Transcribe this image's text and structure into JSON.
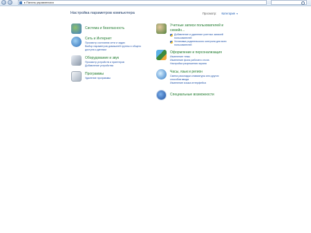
{
  "address": {
    "path": "Панель управления",
    "arrow": "▸"
  },
  "header": {
    "title": "Настройка параметров компьютера",
    "view_by_label": "Просмотр:",
    "view_by_value": "Категория",
    "view_by_arrow": "▾"
  },
  "left": [
    {
      "icon": "system-security-icon",
      "title": "Система и безопасность",
      "links": []
    },
    {
      "icon": "network-internet-icon",
      "title": "Сеть и Интернет",
      "links": [
        "Просмотр состояния сети и задач",
        "Выбор параметров домашней группы и общего",
        "доступа к данным"
      ]
    },
    {
      "icon": "hardware-sound-icon",
      "title": "Оборудование и звук",
      "links": [
        "Просмотр устройств и принтеров",
        "Добавление устройства"
      ]
    },
    {
      "icon": "programs-icon",
      "title": "Программы",
      "links": [
        "Удаление программы"
      ]
    }
  ],
  "right": [
    {
      "icon": "user-accounts-icon",
      "title": [
        "Учетные записи пользователей и",
        "семейн..."
      ],
      "links": [
        "Добавление и удаление учетных записей",
        "пользователей",
        "Установка родительского контроля для всех",
        "пользователей"
      ]
    },
    {
      "icon": "appearance-icon",
      "title": [
        "Оформление и персонализация"
      ],
      "links": [
        "Изменение темы",
        "Изменение фона рабочего стола",
        "Настройка разрешения экрана"
      ]
    },
    {
      "icon": "clock-region-icon",
      "title": [
        "Часы, язык и регион"
      ],
      "links": [
        "Смена раскладки клавиатуры или других",
        "способов ввода",
        "Изменение языка интерфейса"
      ]
    },
    {
      "icon": "ease-of-access-icon",
      "title": [
        "Специальные возможности"
      ],
      "links": []
    }
  ]
}
